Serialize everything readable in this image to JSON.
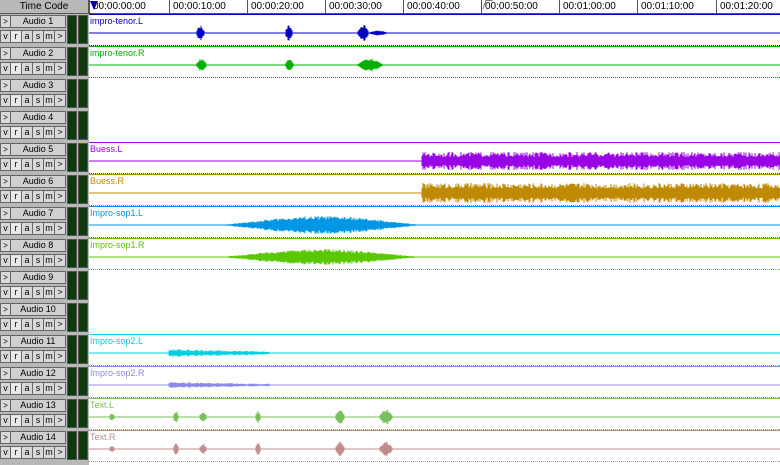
{
  "header": {
    "time_code_label": "Time Code"
  },
  "ruler": {
    "ticks": [
      "00:00:00:00",
      "00:00:10:00",
      "00:00:20:00",
      "00:00:30:00",
      "00:00:40:00",
      "00:00:50:00",
      "00:01:00:00",
      "00:01:10:00",
      "00:01:20:00"
    ]
  },
  "track_buttons": {
    "expand": ">",
    "expand_right": ">",
    "v": "v",
    "r": "r",
    "a": "a",
    "s": "s",
    "m": "m"
  },
  "tracks": [
    {
      "name": "Audio 1",
      "region": "impro-tenor.L",
      "color": "#0000c0"
    },
    {
      "name": "Audio 2",
      "region": "impro-tenor.R",
      "color": "#00b000"
    },
    {
      "name": "Audio 3",
      "region": "",
      "color": ""
    },
    {
      "name": "Audio 4",
      "region": "",
      "color": ""
    },
    {
      "name": "Audio 5",
      "region": "Buess.L",
      "color": "#9a00e6"
    },
    {
      "name": "Audio 6",
      "region": "Buess.R",
      "color": "#c08a00"
    },
    {
      "name": "Audio 7",
      "region": "Impro-sop1.L",
      "color": "#0096e6"
    },
    {
      "name": "Audio 8",
      "region": "Impro-sop1.R",
      "color": "#5ac800"
    },
    {
      "name": "Audio 9",
      "region": "",
      "color": ""
    },
    {
      "name": "Audio 10",
      "region": "",
      "color": ""
    },
    {
      "name": "Audio 11",
      "region": "Impro-sop2.L",
      "color": "#00d0e0"
    },
    {
      "name": "Audio 12",
      "region": "Impro-sop2.R",
      "color": "#8c8ce6"
    },
    {
      "name": "Audio 13",
      "region": "Text.L",
      "color": "#78c05a"
    },
    {
      "name": "Audio 14",
      "region": "Text.R",
      "color": "#c08c8c"
    }
  ]
}
